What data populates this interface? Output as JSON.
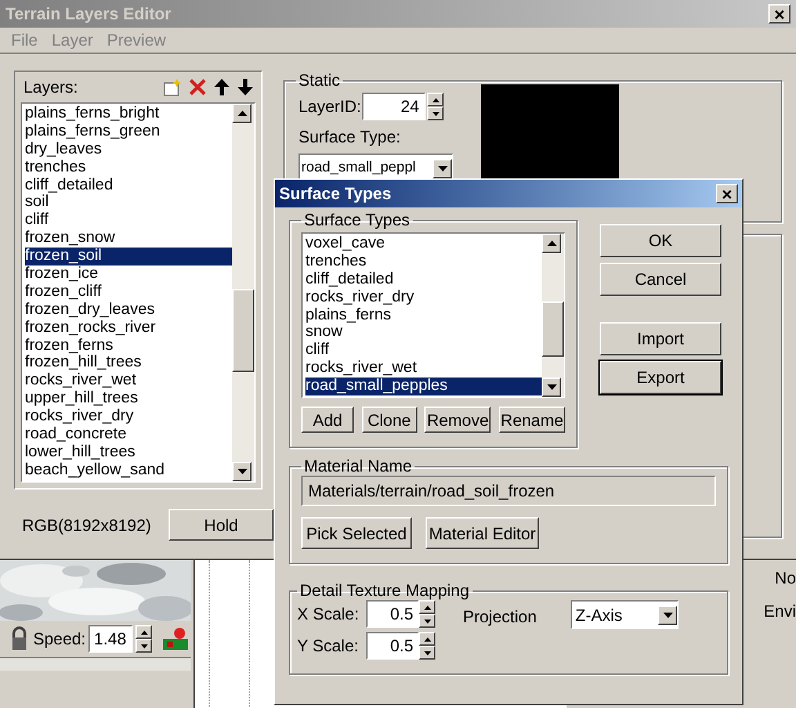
{
  "window": {
    "title": "Terrain Layers Editor",
    "close": "×"
  },
  "menu": [
    {
      "label": "File"
    },
    {
      "label": "Layer"
    },
    {
      "label": "Preview"
    }
  ],
  "layers": {
    "label": "Layers:",
    "items": [
      {
        "label": "plains_ferns_bright",
        "selected": false
      },
      {
        "label": "plains_ferns_green",
        "selected": false
      },
      {
        "label": "dry_leaves",
        "selected": false
      },
      {
        "label": "trenches",
        "selected": false
      },
      {
        "label": "cliff_detailed",
        "selected": false
      },
      {
        "label": "soil",
        "selected": false
      },
      {
        "label": "cliff",
        "selected": false
      },
      {
        "label": "frozen_snow",
        "selected": false
      },
      {
        "label": "frozen_soil",
        "selected": true
      },
      {
        "label": "frozen_ice",
        "selected": false
      },
      {
        "label": "frozen_cliff",
        "selected": false
      },
      {
        "label": "frozen_dry_leaves",
        "selected": false
      },
      {
        "label": "frozen_rocks_river",
        "selected": false
      },
      {
        "label": "frozen_ferns",
        "selected": false
      },
      {
        "label": "frozen_hill_trees",
        "selected": false
      },
      {
        "label": "rocks_river_wet",
        "selected": false
      },
      {
        "label": "upper_hill_trees",
        "selected": false
      },
      {
        "label": "rocks_river_dry",
        "selected": false
      },
      {
        "label": "road_concrete",
        "selected": false
      },
      {
        "label": "lower_hill_trees",
        "selected": false
      },
      {
        "label": "beach_yellow_sand",
        "selected": false
      }
    ],
    "resolution": "RGB(8192x8192)",
    "hold_button": "Hold"
  },
  "static": {
    "title": "Static",
    "layer_id_label": "LayerID:",
    "layer_id": "24",
    "surface_type_label": "Surface Type:",
    "surface_type": "road_small_peppl"
  },
  "bottom": {
    "speed_label": "Speed:",
    "speed": "1.48",
    "side_texts": [
      "No",
      "Envi"
    ]
  },
  "dialog": {
    "title": "Surface Types",
    "close": "×",
    "group_title": "Surface Types",
    "items": [
      {
        "label": "voxel_cave",
        "selected": false
      },
      {
        "label": "trenches",
        "selected": false
      },
      {
        "label": "cliff_detailed",
        "selected": false
      },
      {
        "label": "rocks_river_dry",
        "selected": false
      },
      {
        "label": "plains_ferns",
        "selected": false
      },
      {
        "label": "snow",
        "selected": false
      },
      {
        "label": "cliff",
        "selected": false
      },
      {
        "label": "rocks_river_wet",
        "selected": false
      },
      {
        "label": "road_small_pepples",
        "selected": true
      }
    ],
    "list_buttons": [
      "Add",
      "Clone",
      "Remove",
      "Rename"
    ],
    "side_buttons": [
      {
        "label": "OK",
        "default": false
      },
      {
        "label": "Cancel",
        "default": false
      },
      {
        "label": "Import",
        "default": false
      },
      {
        "label": "Export",
        "default": true
      }
    ],
    "material": {
      "title": "Material Name",
      "value": "Materials/terrain/road_soil_frozen",
      "buttons": [
        "Pick Selected",
        "Material Editor"
      ]
    },
    "mapping": {
      "title": "Detail Texture Mapping",
      "x_label": "X Scale:",
      "x_value": "0.5",
      "y_label": "Y Scale:",
      "y_value": "0.5",
      "projection_label": "Projection",
      "projection": "Z-Axis"
    }
  }
}
